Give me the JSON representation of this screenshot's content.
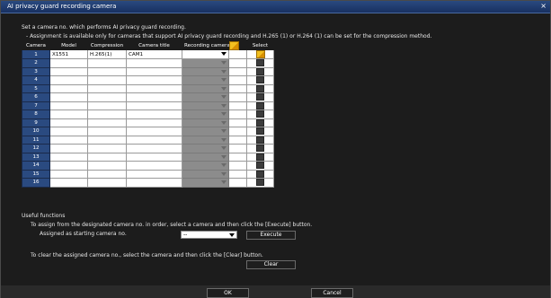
{
  "window": {
    "title": "AI privacy guard recording camera",
    "close_label": "×"
  },
  "instructions": {
    "line1": "Set a camera no. which performs AI privacy guard recording.",
    "line2": "- Assignment is available only for cameras that support AI privacy guard recording and H.265 (1) or H.264 (1) can be set for the compression method."
  },
  "table": {
    "headers": {
      "camera": "Camera",
      "model": "Model",
      "compression": "Compression",
      "camera_title": "Camera title",
      "recording_camera": "Recording camera",
      "select": "Select"
    },
    "rows": [
      {
        "camera": "1",
        "model": "X1551",
        "compression": "H.265(1)",
        "title": "CAM1",
        "recording_camera": "",
        "enabled": true
      },
      {
        "camera": "2"
      },
      {
        "camera": "3"
      },
      {
        "camera": "4"
      },
      {
        "camera": "5"
      },
      {
        "camera": "6"
      },
      {
        "camera": "7"
      },
      {
        "camera": "8"
      },
      {
        "camera": "9"
      },
      {
        "camera": "10"
      },
      {
        "camera": "11"
      },
      {
        "camera": "12"
      },
      {
        "camera": "13"
      },
      {
        "camera": "14"
      },
      {
        "camera": "15"
      },
      {
        "camera": "16"
      }
    ]
  },
  "useful": {
    "heading": "Useful functions",
    "assign_text": "To assign from the designated camera no. in order, select a camera and then click the [Execute] button.",
    "assign_label": "Assigned as starting camera no.",
    "start_value": "--",
    "execute_label": "Execute",
    "clear_text": "To clear the assigned camera no., select the camera and then click the [Clear] button.",
    "clear_label": "Clear"
  },
  "footer": {
    "ok_label": "OK",
    "cancel_label": "Cancel"
  },
  "colors": {
    "title_bar": "#2a4a80",
    "camera_cell": "#2a4a80",
    "disabled_cell": "#8c8c8c",
    "pencil": "#f2c020"
  }
}
